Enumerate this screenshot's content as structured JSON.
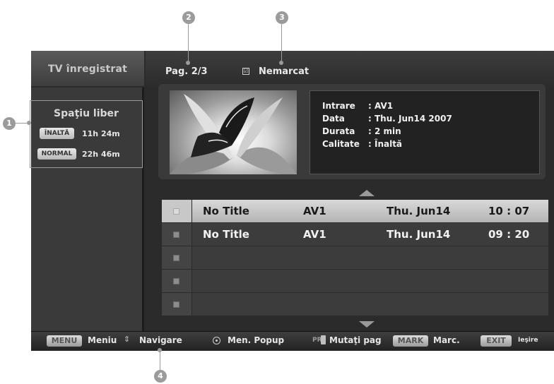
{
  "sidebar": {
    "title": "TV înregistrat",
    "free_space": {
      "title": "Spaţiu liber",
      "rows": [
        {
          "badge": "ÎNALTĂ",
          "time": "11h 24m"
        },
        {
          "badge": "NORMAL",
          "time": "22h 46m"
        }
      ]
    }
  },
  "header": {
    "page": "Pag. 2/3",
    "check_glyph": "☑",
    "unmarked": "Nemarcat"
  },
  "info": {
    "input_key": "Intrare",
    "input_val": ": AV1",
    "date_key": "Data",
    "date_val": ":  Thu. Jun14 2007",
    "duration_key": "Durata",
    "duration_val": ": 2 min",
    "quality_key": "Calitate",
    "quality_val": ": Înaltă"
  },
  "recordings": [
    {
      "title": "No Title",
      "source": "AV1",
      "date": "Thu. Jun14",
      "time": "10 : 07",
      "selected": true
    },
    {
      "title": "No Title",
      "source": "AV1",
      "date": "Thu. Jun14",
      "time": "09 : 20",
      "selected": false
    },
    {
      "title": "",
      "source": "",
      "date": "",
      "time": "",
      "selected": false
    },
    {
      "title": "",
      "source": "",
      "date": "",
      "time": "",
      "selected": false
    },
    {
      "title": "",
      "source": "",
      "date": "",
      "time": "",
      "selected": false
    }
  ],
  "footer": {
    "menu_key": "MENU",
    "menu_label": "Meniu",
    "nav_glyph": "⇕",
    "nav_label": "Navigare",
    "popup_label": "Men. Popup",
    "pr_text": "PR",
    "move_label": "Mutaţi pag",
    "mark_key": "MARK",
    "mark_label": "Marc.",
    "exit_key": "EXIT",
    "exit_label": "Ieşire"
  },
  "callouts": [
    "1",
    "2",
    "3",
    "4"
  ],
  "colors": {
    "background": "#2b2b2b",
    "selected_row": "#c8c8c8",
    "callout": "#9b9b9b"
  }
}
